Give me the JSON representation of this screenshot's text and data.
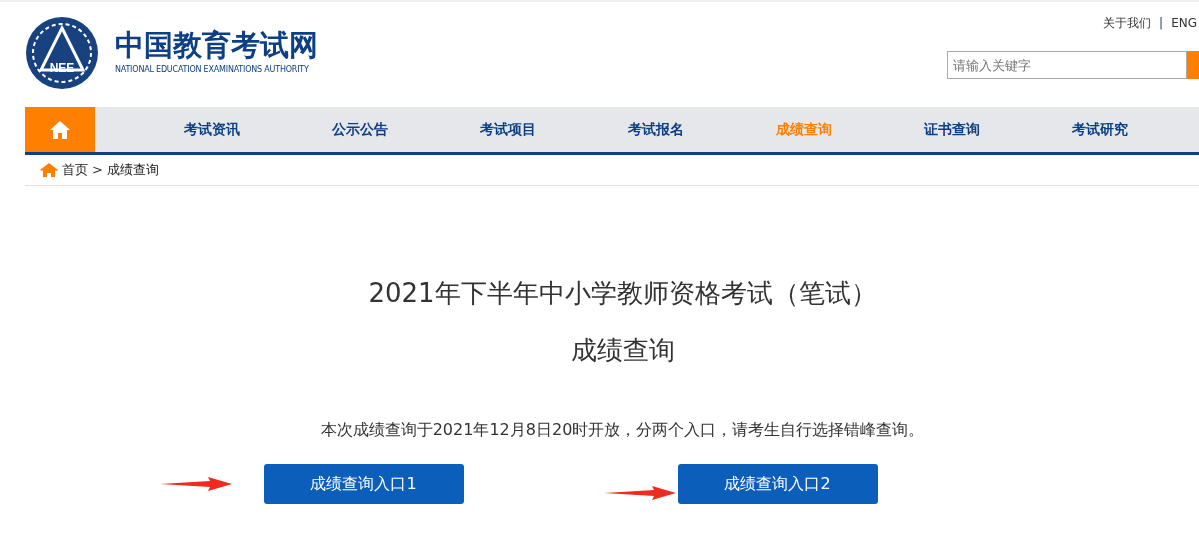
{
  "logo": {
    "emblem_text": "NEE",
    "title": "中国教育考试网",
    "subtitle": "NATIONAL EDUCATION EXAMINATIONS AUTHORITY"
  },
  "top_links": [
    "关于我们",
    "ENG"
  ],
  "top_separator": "|",
  "breadcrumb_separator": ">",
  "search": {
    "placeholder": "请输入关键字"
  },
  "nav": [
    {
      "label": "考试资讯",
      "selected": false
    },
    {
      "label": "公示公告",
      "selected": false
    },
    {
      "label": "考试项目",
      "selected": false
    },
    {
      "label": "考试报名",
      "selected": false
    },
    {
      "label": "成绩查询",
      "selected": true
    },
    {
      "label": "证书查询",
      "selected": false
    },
    {
      "label": "考试研究",
      "selected": false
    }
  ],
  "breadcrumb": [
    "首页",
    "成绩查询"
  ],
  "title_lines": [
    "2021年下半年中小学教师资格考试（笔试）",
    "成绩查询"
  ],
  "notice": "本次成绩查询于2021年12月8日20时开放，分两个入口，请考生自行选择错峰查询。",
  "entries": [
    "成绩查询入口1",
    "成绩查询入口2"
  ]
}
